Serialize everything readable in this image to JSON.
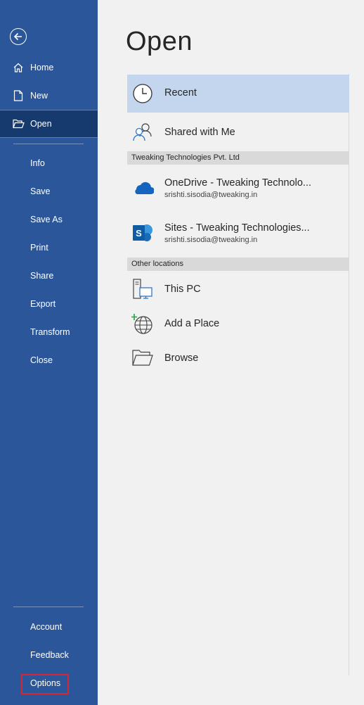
{
  "sidebar": {
    "top_items": [
      {
        "label": "Home"
      },
      {
        "label": "New"
      },
      {
        "label": "Open"
      }
    ],
    "items": [
      {
        "label": "Info"
      },
      {
        "label": "Save"
      },
      {
        "label": "Save As"
      },
      {
        "label": "Print"
      },
      {
        "label": "Share"
      },
      {
        "label": "Export"
      },
      {
        "label": "Transform"
      },
      {
        "label": "Close"
      }
    ],
    "bottom_items": [
      {
        "label": "Account"
      },
      {
        "label": "Feedback"
      },
      {
        "label": "Options"
      }
    ]
  },
  "main": {
    "title": "Open",
    "recent": {
      "label": "Recent"
    },
    "shared": {
      "label": "Shared with Me"
    },
    "org_header": "Tweaking Technologies Pvt. Ltd",
    "onedrive": {
      "name": "OneDrive - Tweaking Technolo...",
      "email": "srishti.sisodia@tweaking.in"
    },
    "sites": {
      "name": "Sites - Tweaking Technologies...",
      "email": "srishti.sisodia@tweaking.in"
    },
    "other_header": "Other locations",
    "this_pc": {
      "label": "This PC"
    },
    "add_place": {
      "label": "Add a Place"
    },
    "browse": {
      "label": "Browse"
    }
  },
  "colors": {
    "sidebar": "#2b579a",
    "sidebar_active": "#163a6e",
    "selected_row": "#c4d6ee",
    "highlight_box": "#d9262c"
  }
}
